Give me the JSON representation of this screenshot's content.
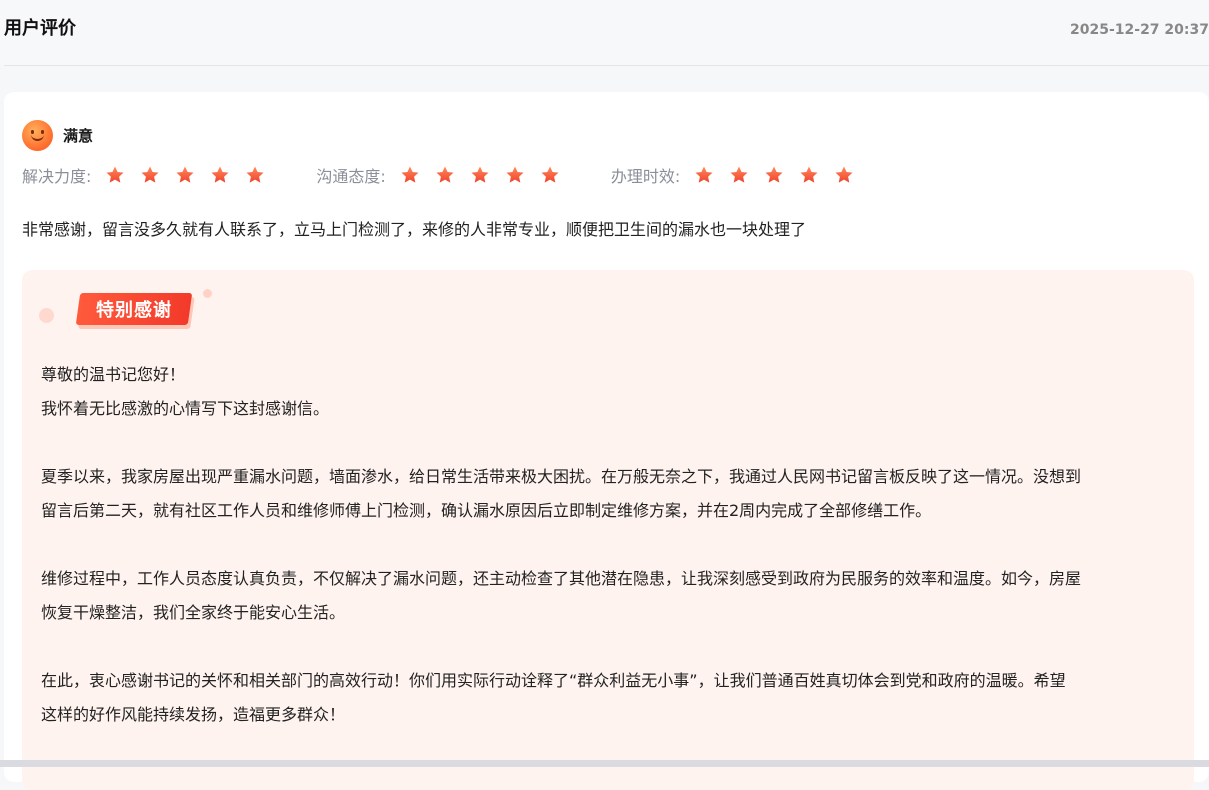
{
  "header": {
    "title": "用户评价",
    "time": "2025-12-27 20:37"
  },
  "rating": {
    "label": "满意",
    "icon": "smile-face-icon",
    "accent_color": "#ff6a2c",
    "scores": [
      {
        "label": "解决力度:",
        "stars": 5
      },
      {
        "label": "沟通态度:",
        "stars": 5
      },
      {
        "label": "办理时效:",
        "stars": 5
      }
    ]
  },
  "comment": "非常感谢，留言没多久就有人联系了，立马上门检测了，来修的人非常专业，顺便把卫生间的漏水也一块处理了",
  "thanks": {
    "badge": "特别感谢",
    "badge_color": "#f23a2a",
    "lines": [
      "尊敬的温书记您好！",
      "我怀着无比感激的心情写下这封感谢信。",
      "",
      "夏季以来，我家房屋出现严重漏水问题，墙面渗水，给日常生活带来极大困扰。在万般无奈之下，我通过人民网书记留言板反映了这一情况。没想到",
      "留言后第二天，就有社区工作人员和维修师傅上门检测，确认漏水原因后立即制定维修方案，并在2周内完成了全部修缮工作。",
      "",
      "维修过程中，工作人员态度认真负责，不仅解决了漏水问题，还主动检查了其他潜在隐患，让我深刻感受到政府为民服务的效率和温度。如今，房屋",
      "恢复干燥整洁，我们全家终于能安心生活。",
      "",
      "在此，衷心感谢书记的关怀和相关部门的高效行动！你们用实际行动诠释了“群众利益无小事”，让我们普通百姓真切体会到党和政府的温暖。希望",
      "这样的好作风能持续发扬，造福更多群众！"
    ]
  }
}
